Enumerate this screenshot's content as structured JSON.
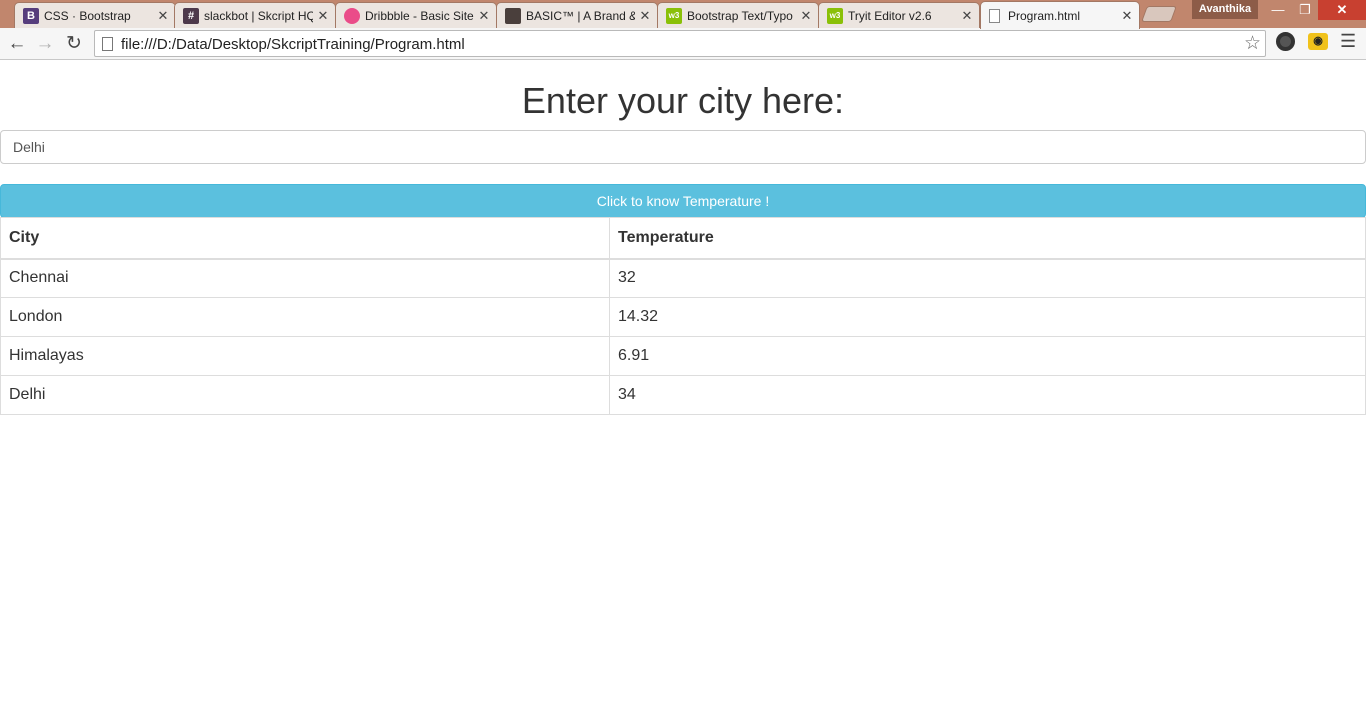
{
  "browser": {
    "tabs": [
      {
        "title": "CSS · Bootstrap",
        "favicon": "bootstrap-icon",
        "favicon_glyph": "B",
        "favicon_color": "#563d7c"
      },
      {
        "title": "slackbot | Skcript HQ",
        "favicon": "hashtag-icon",
        "favicon_glyph": "#",
        "favicon_color": "#4d394b"
      },
      {
        "title": "Dribbble - Basic Site",
        "favicon": "dribbble-icon",
        "favicon_glyph": "",
        "favicon_color": "#ea4c89"
      },
      {
        "title": "BASIC™ | A Brand &",
        "favicon": "basic-brand-icon",
        "favicon_glyph": "",
        "favicon_color": "#4a3f3c"
      },
      {
        "title": "Bootstrap Text/Typo",
        "favicon": "w3-icon",
        "favicon_glyph": "w3",
        "favicon_color": "#8ac007"
      },
      {
        "title": "Tryit Editor v2.6",
        "favicon": "w3-icon",
        "favicon_glyph": "w3",
        "favicon_color": "#8ac007"
      },
      {
        "title": "Program.html",
        "favicon": "page-icon",
        "favicon_glyph": "",
        "favicon_color": "#ffffff"
      }
    ],
    "profile_name": "Avanthika",
    "url": "file:///D:/Data/Desktop/SkcriptTraining/Program.html"
  },
  "page": {
    "heading": "Enter your city here:",
    "city_input": {
      "value": "Delhi",
      "placeholder": ""
    },
    "button_label": "Click to know Temperature !",
    "table": {
      "headers": [
        "City",
        "Temperature"
      ],
      "rows": [
        [
          "Chennai",
          "32"
        ],
        [
          "London",
          "14.32"
        ],
        [
          "Himalayas",
          "6.91"
        ],
        [
          "Delhi",
          "34"
        ]
      ]
    }
  },
  "colors": {
    "button_bg": "#5bc0de",
    "title_bar": "#c1866d",
    "close_button": "#c84030"
  }
}
